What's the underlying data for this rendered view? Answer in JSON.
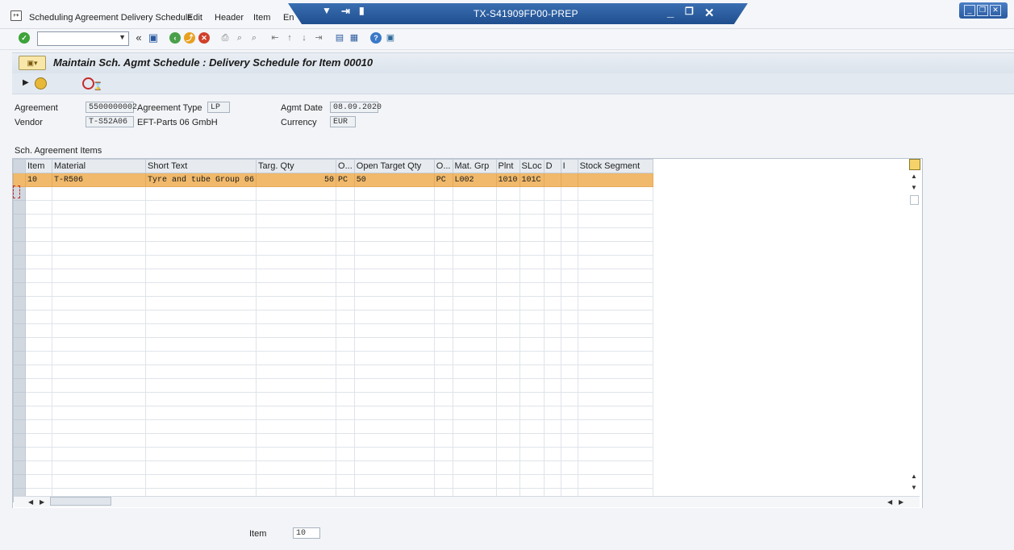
{
  "menubar": {
    "items": [
      "Scheduling Agreement Delivery Schedule",
      "Edit",
      "Header",
      "Item",
      "En"
    ]
  },
  "session": {
    "title": "TX-S41909FP00-PREP"
  },
  "page": {
    "title": "Maintain Sch. Agmt Schedule : Delivery Schedule for Item 00010"
  },
  "header": {
    "agreement_label": "Agreement",
    "agreement_value": "5500000002",
    "agreement_type_label": "Agreement Type",
    "agreement_type_value": "LP",
    "agmt_date_label": "Agmt Date",
    "agmt_date_value": "08.09.2020",
    "vendor_label": "Vendor",
    "vendor_value": "T-S52A06",
    "vendor_name": "EFT-Parts 06 GmbH",
    "currency_label": "Currency",
    "currency_value": "EUR"
  },
  "items_section": {
    "title": "Sch. Agreement Items"
  },
  "table": {
    "columns": [
      "Item",
      "Material",
      "Short Text",
      "Targ. Qty",
      "O...",
      "Open Target Qty",
      "O...",
      "Mat. Grp",
      "Plnt",
      "SLoc",
      "D",
      "I",
      "Stock Segment"
    ],
    "rows": [
      [
        "10",
        "T-R506",
        "Tyre and tube Group 06",
        "50",
        "PC",
        "50",
        "PC",
        "L002",
        "1010",
        "101C",
        "",
        "",
        ""
      ]
    ]
  },
  "footer": {
    "item_label": "Item",
    "item_value": "10"
  },
  "colors": {
    "selected_row": "#f0b96b",
    "title_bar": "#1f4e8e"
  }
}
